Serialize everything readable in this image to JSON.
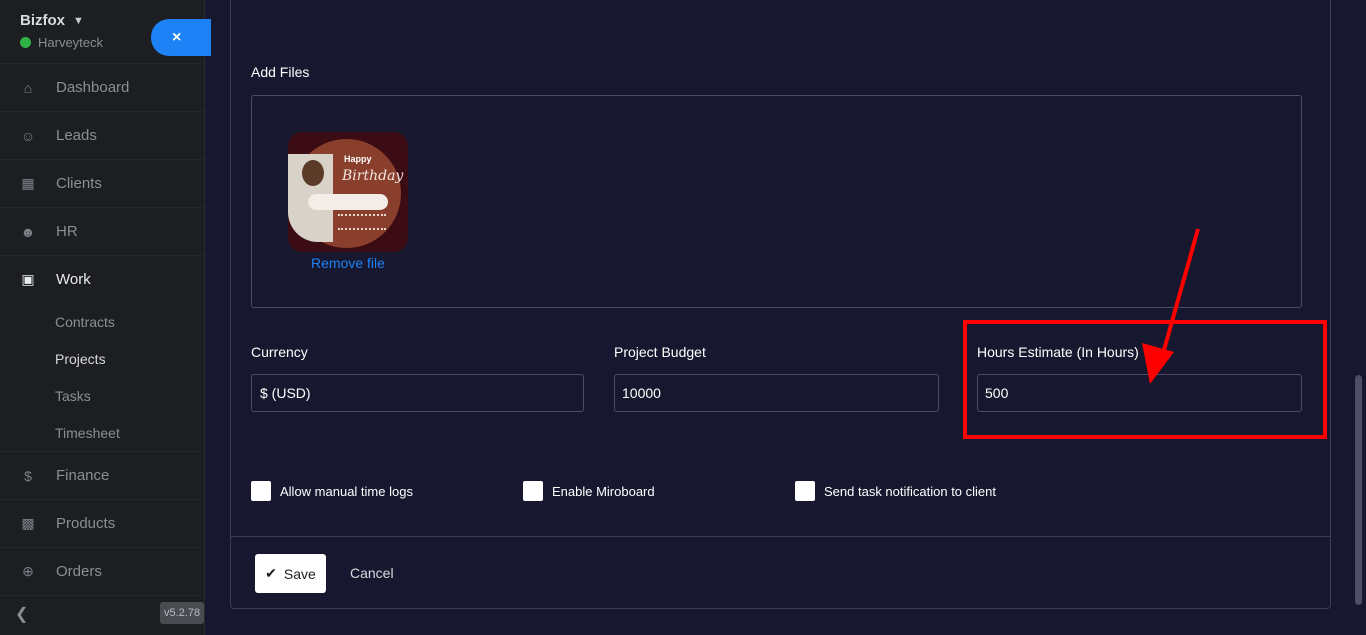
{
  "workspace": {
    "name": "Bizfox",
    "account": "Harveyteck",
    "close_symbol": "×"
  },
  "sidebar": {
    "items": [
      {
        "label": "Dashboard",
        "icon": "home-icon"
      },
      {
        "label": "Leads",
        "icon": "user-icon"
      },
      {
        "label": "Clients",
        "icon": "building-icon"
      },
      {
        "label": "HR",
        "icon": "people-icon"
      },
      {
        "label": "Work",
        "icon": "briefcase-icon"
      }
    ],
    "work_sub": [
      "Contracts",
      "Projects",
      "Tasks",
      "Timesheet"
    ],
    "items_after": [
      {
        "label": "Finance",
        "icon": "dollar-icon"
      },
      {
        "label": "Products",
        "icon": "basket-icon"
      },
      {
        "label": "Orders",
        "icon": "cart-icon"
      }
    ],
    "version": "v5.2.78"
  },
  "form": {
    "add_files_label": "Add Files",
    "remove_file": "Remove file",
    "file_thumbnail_text": {
      "line1": "Happy",
      "line2": "Birthday"
    },
    "currency": {
      "label": "Currency",
      "value": "$ (USD)"
    },
    "budget": {
      "label": "Project Budget",
      "value": "10000"
    },
    "hours": {
      "label": "Hours Estimate (In Hours)",
      "value": "500"
    },
    "checkboxes": [
      "Allow manual time logs",
      "Enable Miroboard",
      "Send task notification to client"
    ],
    "save_label": "Save",
    "cancel_label": "Cancel"
  },
  "colors": {
    "accent": "#1d82f5",
    "annotation": "#ff0000",
    "background": "#17182f"
  }
}
